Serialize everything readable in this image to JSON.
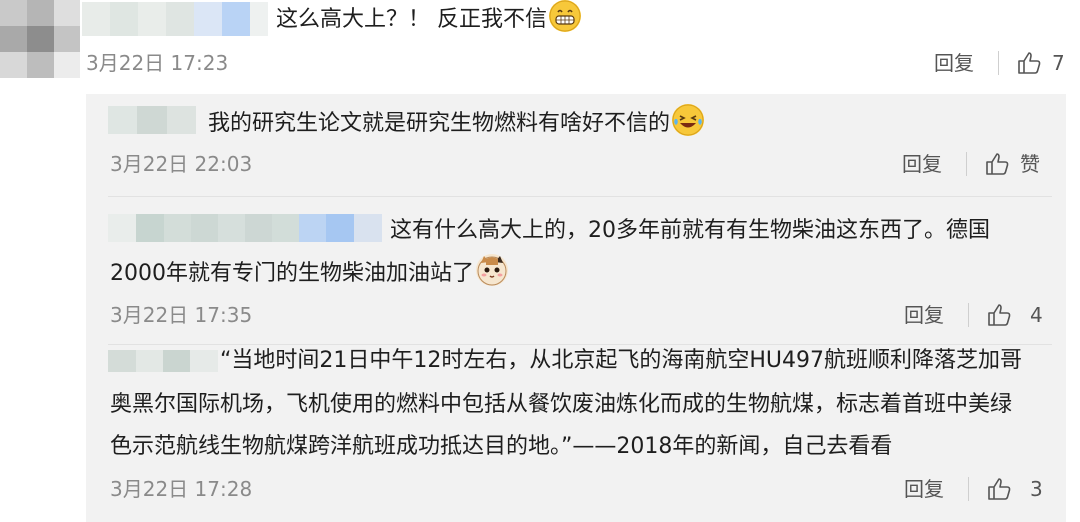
{
  "colors": {
    "meta_text": "#8a8a8a",
    "sub_panel_bg": "#f2f2f2",
    "emoji_yellow": "#f7c83a"
  },
  "comment_main": {
    "text": "这么高大上？！ 反正我不信",
    "emoji": "grin-emoji",
    "date": "3月22日 17:23",
    "reply_label": "回复",
    "like_count": "7"
  },
  "replies": [
    {
      "text": "我的研究生论文就是研究生物燃料有啥好不信的",
      "emoji": "laugh-cry-emoji",
      "date": "3月22日 22:03",
      "reply_label": "回复",
      "like_label": "赞"
    },
    {
      "text_line1": "这有什么高大上的，20多年前就有有生物柴油这东西了。德国",
      "text_line2": "2000年就有专门的生物柴油加油站了",
      "emoji": "cat-emoji",
      "date": "3月22日 17:35",
      "reply_label": "回复",
      "like_count": "4"
    },
    {
      "text_line1": "“当地时间21日中午12时左右，从北京起飞的海南航空HU497航班顺利降落芝加哥",
      "text_line2": "奥黑尔国际机场，飞机使用的燃料中包括从餐饮废油炼化而成的生物航煤，标志着首班中美绿",
      "text_line3": "色示范航线生物航煤跨洋航班成功抵达目的地。”——2018年的新闻，自己去看看",
      "date": "3月22日 17:28",
      "reply_label": "回复",
      "like_count": "3"
    }
  ]
}
